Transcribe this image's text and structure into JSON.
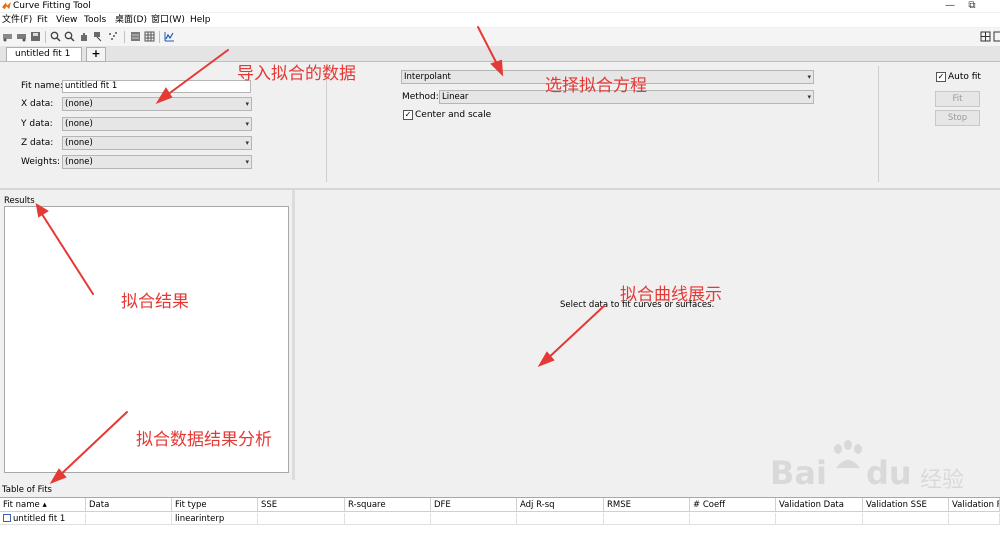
{
  "window": {
    "title": "Curve Fitting Tool",
    "maximize_glyph": "⧉",
    "close_glyph": "✕"
  },
  "menu": [
    "文件(F)",
    "Fit",
    "View",
    "Tools",
    "桌面(D)",
    "窗口(W)",
    "Help"
  ],
  "tabs": {
    "active": "untitled fit 1",
    "add": "+"
  },
  "fit_form": {
    "fit_name_label": "Fit name:",
    "fit_name_value": "untitled fit 1",
    "x_label": "X data:",
    "x_value": "(none)",
    "y_label": "Y data:",
    "y_value": "(none)",
    "z_label": "Z data:",
    "z_value": "(none)",
    "w_label": "Weights:",
    "w_value": "(none)"
  },
  "fit_type": {
    "type_value": "Interpolant",
    "method_label": "Method:",
    "method_value": "Linear",
    "center_scale_label": "Center and scale",
    "center_scale_checked": true
  },
  "controls": {
    "auto_fit_label": "Auto fit",
    "auto_fit_checked": true,
    "fit_button": "Fit",
    "stop_button": "Stop"
  },
  "results": {
    "header": "Results"
  },
  "plot": {
    "message": "Select data to fit curves or surfaces."
  },
  "table_of_fits": {
    "header": "Table of Fits",
    "columns": [
      "Fit name ▴",
      "Data",
      "Fit type",
      "SSE",
      "R-square",
      "DFE",
      "Adj R-sq",
      "RMSE",
      "# Coeff",
      "Validation Data",
      "Validation SSE",
      "Validation R"
    ],
    "rows": [
      [
        "untitled fit 1",
        "",
        "linearinterp",
        "",
        "",
        "",
        "",
        "",
        "",
        "",
        "",
        ""
      ]
    ]
  },
  "annotations": {
    "import_data": "导入拟合的数据",
    "choose_equation": "选择拟合方程",
    "fit_result": "拟合结果",
    "curve_display": "拟合曲线展示",
    "result_analysis": "拟合数据结果分析"
  },
  "watermark": {
    "brand": "Bai",
    "brand_tail": "du",
    "suffix": "经验"
  },
  "colors": {
    "annotation": "#e53935",
    "window_bg": "#f0f0f0"
  }
}
